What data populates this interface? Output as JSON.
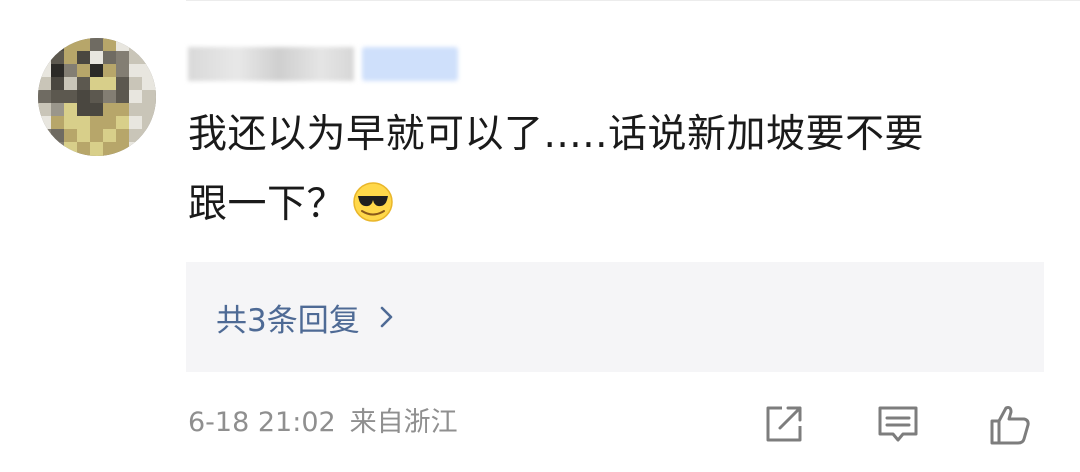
{
  "comment": {
    "line1": "我还以为早就可以了.....话说新加坡要不要",
    "line2": "跟一下？",
    "emoji": "sunglasses-emoji"
  },
  "replies": {
    "label": "共3条回复"
  },
  "meta": {
    "time": "6-18 21:02",
    "location": "来自浙江"
  },
  "actions": [
    "share-icon",
    "comment-icon",
    "like-icon"
  ],
  "colors": {
    "link": "#4e6a95",
    "meta": "#8f8f8f",
    "reply_bg": "#f5f5f7",
    "text": "#1a1a1a"
  }
}
